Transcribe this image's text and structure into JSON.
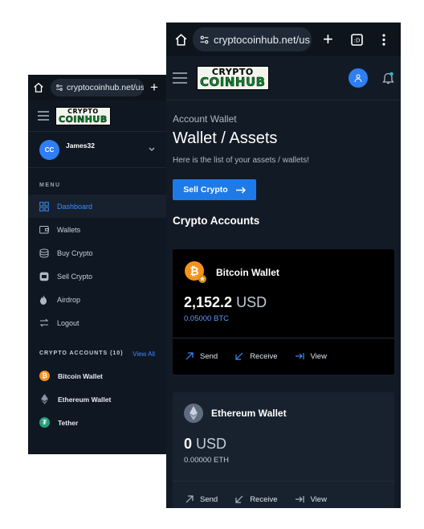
{
  "browser": {
    "url": "cryptocoinhub.net/us",
    "url_short": "cryptocoinhub.net/us"
  },
  "logo": {
    "line1": "CRYPTO",
    "line2": "COINHUB"
  },
  "left": {
    "user": {
      "initials": "CC",
      "name": "James32"
    },
    "menu_heading": "MENU",
    "menu": [
      {
        "label": "Dashboard",
        "icon": "dashboard-icon",
        "active": true
      },
      {
        "label": "Wallets",
        "icon": "wallet-icon"
      },
      {
        "label": "Buy Crypto",
        "icon": "buy-crypto-icon"
      },
      {
        "label": "Sell Crypto",
        "icon": "sell-crypto-icon"
      },
      {
        "label": "Airdrop",
        "icon": "flame-icon"
      },
      {
        "label": "Logout",
        "icon": "logout-icon"
      }
    ],
    "accounts_heading": "CRYPTO ACCOUNTS (10)",
    "view_all": "View All",
    "accounts": [
      {
        "label": "Bitcoin Wallet",
        "color": "#f7931a",
        "glyph": "₿"
      },
      {
        "label": "Ethereum Wallet",
        "color": "#8a94a6",
        "glyph": "◆"
      },
      {
        "label": "Tether",
        "color": "#26a17b",
        "glyph": "₮"
      }
    ]
  },
  "right": {
    "breadcrumb": "Account Wallet",
    "title": "Wallet / Assets",
    "subtitle": "Here is the list of your assets / wallets!",
    "sell_button": "Sell Crypto",
    "section_title": "Crypto Accounts",
    "cards": [
      {
        "name": "Bitcoin Wallet",
        "amount": "2,152.2",
        "currency": "USD",
        "crypto": "0.05000 BTC",
        "actions": [
          "Send",
          "Receive",
          "View"
        ]
      },
      {
        "name": "Ethereum Wallet",
        "amount": "0",
        "currency": "USD",
        "crypto": "0.00000 ETH",
        "actions": [
          "Send",
          "Receive",
          "View"
        ]
      }
    ]
  },
  "colors": {
    "accent": "#2f7ef3",
    "bitcoin": "#f7931a",
    "tether": "#26a17b"
  }
}
